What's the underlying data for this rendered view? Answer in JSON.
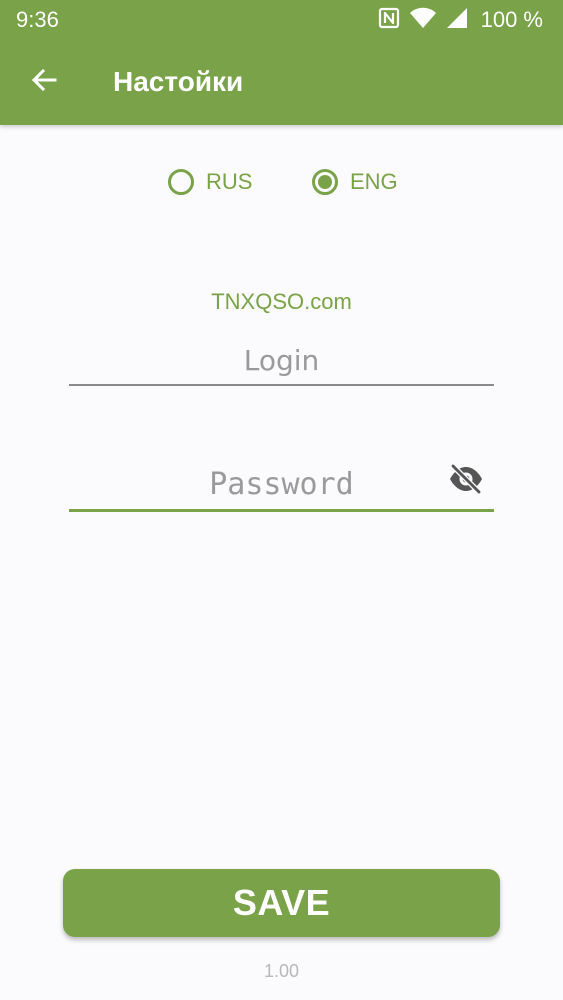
{
  "status_bar": {
    "time": "9:36",
    "battery": "100 %",
    "icons": [
      "nfc-icon",
      "wifi-icon",
      "signal-icon"
    ]
  },
  "app_bar": {
    "title": "Настойки",
    "back_icon": "arrow-left-icon"
  },
  "language": {
    "options": [
      {
        "label": "RUS",
        "selected": false
      },
      {
        "label": "ENG",
        "selected": true
      }
    ]
  },
  "form": {
    "site_label": "TNXQSO.com",
    "login_placeholder": "Login",
    "login_value": "",
    "password_placeholder": "Password",
    "password_value": "",
    "password_toggle_icon": "eye-off-icon"
  },
  "save_label": "SAVE",
  "version": "1.00",
  "colors": {
    "primary": "#7aa249",
    "background": "#fbfafc",
    "underline_inactive": "#8a8a8a",
    "version_text": "#b8b8b8"
  }
}
